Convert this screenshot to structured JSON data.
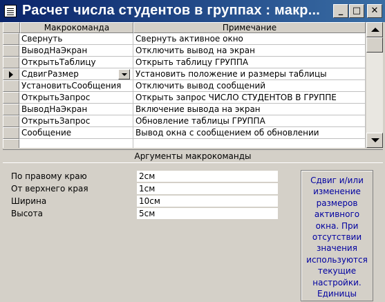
{
  "window": {
    "title": "Расчет числа студентов в группах : макр...",
    "buttons": {
      "minimize": "_",
      "maximize": "□",
      "close": "✕"
    }
  },
  "grid": {
    "columns": [
      "Макрокоманда",
      "Примечание"
    ],
    "rows": [
      {
        "action": "Свернуть",
        "note": "Свернуть активное окно"
      },
      {
        "action": "ВыводНаЭкран",
        "note": "Отключить вывод на экран"
      },
      {
        "action": "ОткрытьТаблицу",
        "note": "Открыть таблицу ГРУППА"
      },
      {
        "action": "СдвигРазмер",
        "note": "Установить положение и размеры таблицы"
      },
      {
        "action": "УстановитьСообщения",
        "note": "Отключить вывод сообщений"
      },
      {
        "action": "ОткрытьЗапрос",
        "note": "Открыть запрос ЧИСЛО СТУДЕНТОВ В ГРУППЕ"
      },
      {
        "action": "ВыводНаЭкран",
        "note": "Включение вывода на экран"
      },
      {
        "action": "ОткрытьЗапрос",
        "note": "Обновление таблицы ГРУППА"
      },
      {
        "action": "Сообщение",
        "note": "Вывод окна с сообщением об обновлении"
      },
      {
        "action": "",
        "note": ""
      }
    ],
    "current_row": 3
  },
  "arguments": {
    "title": "Аргументы макрокоманды",
    "fields": [
      {
        "label": "По правому краю",
        "value": "2см"
      },
      {
        "label": "От верхнего края",
        "value": "1см"
      },
      {
        "label": "Ширина",
        "value": "10см"
      },
      {
        "label": "Высота",
        "value": "5см"
      }
    ],
    "hint": "Сдвиг и/или изменение размеров активного окна. При отсутствии значения используются текущие настройки. Единицы"
  },
  "colors": {
    "title_start": "#0a246a",
    "title_end": "#3a6ea5",
    "hint_text": "#0000a0",
    "face": "#d4d0c8"
  },
  "icons": [
    "macro-window-icon",
    "row-pointer-icon",
    "dropdown-arrow-icon",
    "scroll-up-icon",
    "scroll-down-icon"
  ]
}
